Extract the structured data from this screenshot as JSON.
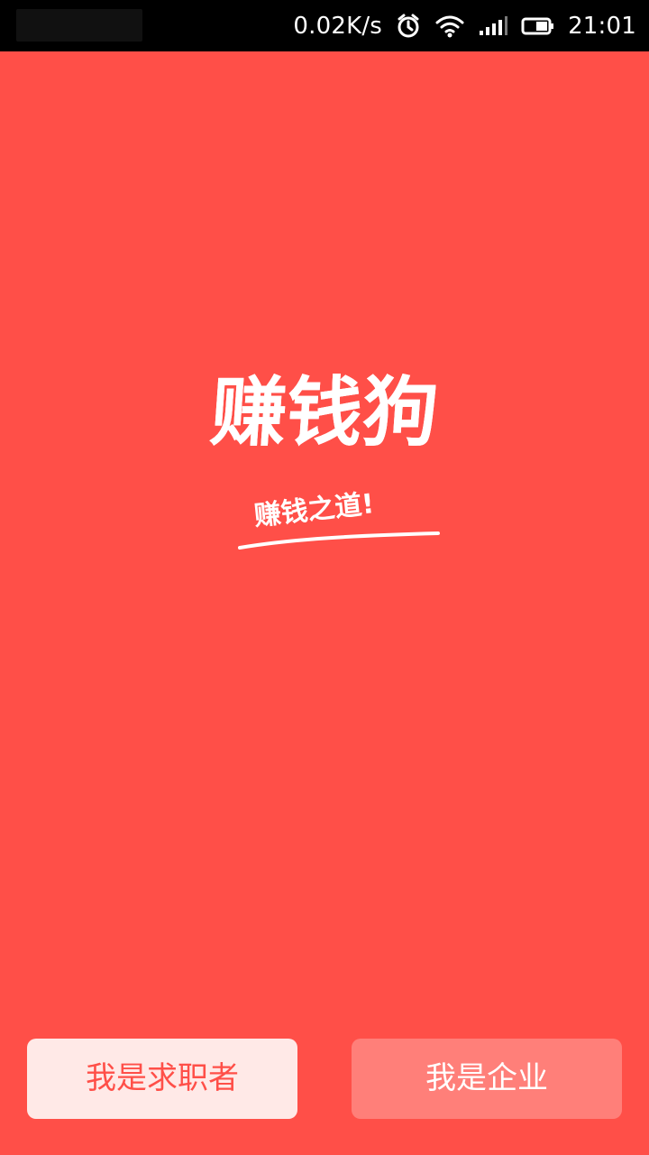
{
  "status_bar": {
    "network_speed": "0.02K/s",
    "time": "21:01",
    "icons": {
      "alarm": "alarm-icon",
      "wifi": "wifi-icon",
      "signal": "signal-icon",
      "battery": "battery-icon"
    }
  },
  "brand": {
    "title": "赚钱狗",
    "slogan": "赚钱之道!"
  },
  "actions": {
    "jobseeker_label": "我是求职者",
    "enterprise_label": "我是企业"
  },
  "colors": {
    "background": "#ff4f48",
    "status_bar": "#000000",
    "primary_text": "#ffffff",
    "jobseeker_button_bg": "#ffe9e7",
    "enterprise_button_bg": "#ff7f79"
  }
}
